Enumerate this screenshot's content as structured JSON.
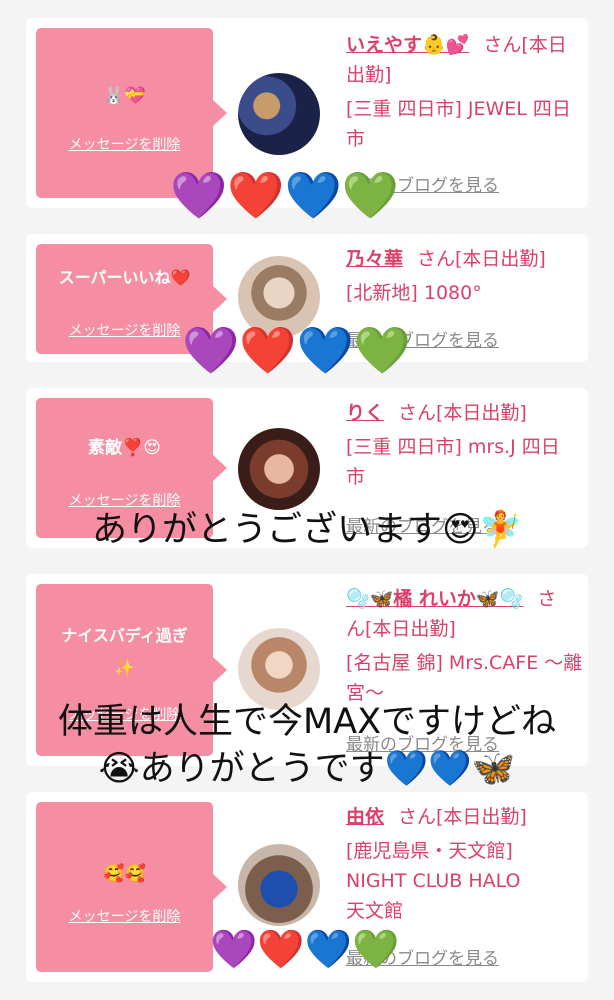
{
  "cards": [
    {
      "bubble_text": "🐰💝",
      "delete_label": "メッセージを削除",
      "name": "いえやす👶💕",
      "suffix": "さん[本日出勤]",
      "shop": "[三重 四日市] JEWEL 四日市",
      "blog_link": "最新のブログを見る",
      "hearts": [
        "💜",
        "❤️",
        "💙",
        "💚"
      ]
    },
    {
      "bubble_text": "スーパーいいね❤️",
      "delete_label": "メッセージを削除",
      "name": "乃々華",
      "suffix": "さん[本日出勤]",
      "shop": "[北新地] 1080°",
      "blog_link": "最新のブログを見る",
      "hearts": [
        "💜",
        "❤️",
        "💙",
        "💚"
      ]
    },
    {
      "bubble_text": "素敵❣️😍",
      "delete_label": "メッセージを削除",
      "name": "りく",
      "suffix": "さん[本日出勤]",
      "shop": "[三重 四日市] mrs.J 四日市",
      "blog_link": "最新のブログを見る"
    },
    {
      "bubble_text": "ナイスバディ過ぎ✨",
      "delete_label": "メッセージを削除",
      "name": "🫧🦋橘 れいか🦋🫧",
      "suffix": "さん[本日出勤]",
      "shop": "[名古屋 錦] Mrs.CAFE 〜離宮〜",
      "blog_link": "最新のブログを見る"
    },
    {
      "bubble_text": "🥰🥰",
      "delete_label": "メッセージを削除",
      "name": "由依",
      "suffix": "さん[本日出勤]",
      "shop": "[鹿児島県・天文館] NIGHT CLUB HALO 天文館",
      "blog_link": "最新のブログを見る",
      "hearts": [
        "💜",
        "❤️",
        "💙",
        "💚"
      ]
    }
  ],
  "captions": {
    "first": "ありがとうございます😍🧚",
    "second_line1": "体重は人生で今MAXですけどね",
    "second_line2": "😭ありがとうです💙💙🦋"
  }
}
